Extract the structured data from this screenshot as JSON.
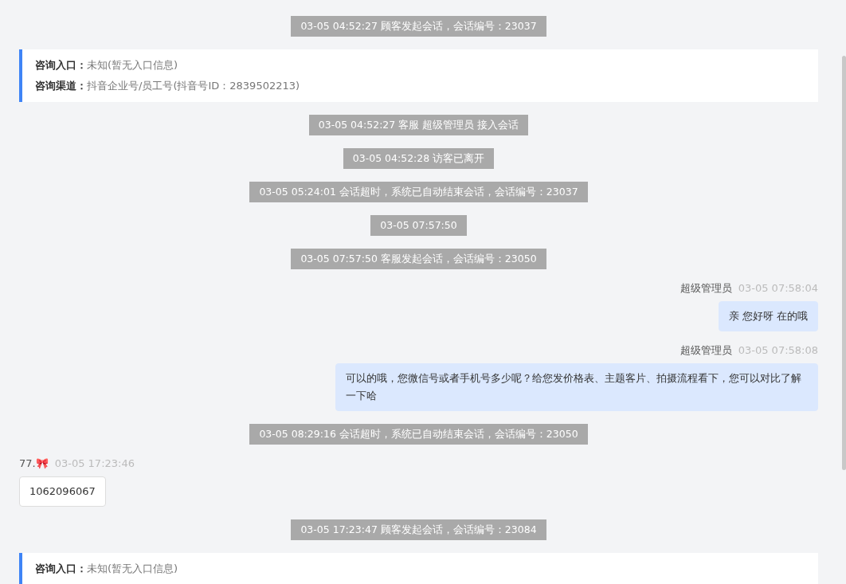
{
  "messages": [
    {
      "kind": "system",
      "text": "03-05 04:52:27 顾客发起会话，会话编号：23037"
    },
    {
      "kind": "info",
      "rows": [
        {
          "label": "咨询入口：",
          "value": "未知(暂无入口信息)"
        },
        {
          "label": "咨询渠道：",
          "value": "抖音企业号/员工号(抖音号ID：2839502213)"
        }
      ]
    },
    {
      "kind": "system",
      "text": "03-05 04:52:27 客服 超级管理员 接入会话"
    },
    {
      "kind": "system",
      "text": "03-05 04:52:28 访客已离开"
    },
    {
      "kind": "system",
      "text": "03-05 05:24:01 会话超时，系统已自动结束会话，会话编号：23037"
    },
    {
      "kind": "system",
      "text": "03-05 07:57:50"
    },
    {
      "kind": "system",
      "text": "03-05 07:57:50 客服发起会话，会话编号：23050"
    },
    {
      "kind": "agent",
      "sender": "超级管理员",
      "time": "03-05 07:58:04",
      "text": "亲 您好呀 在的哦"
    },
    {
      "kind": "agent",
      "sender": "超级管理员",
      "time": "03-05 07:58:08",
      "text": "可以的哦，您微信号或者手机号多少呢？给您发价格表、主题客片、拍摄流程看下，您可以对比了解一下哈"
    },
    {
      "kind": "system",
      "text": "03-05 08:29:16 会话超时，系统已自动结束会话，会话编号：23050"
    },
    {
      "kind": "visitor",
      "sender": "77.🎀",
      "time": "03-05 17:23:46",
      "text": "1062096067"
    },
    {
      "kind": "system",
      "text": "03-05 17:23:47 顾客发起会话，会话编号：23084"
    },
    {
      "kind": "info",
      "rows": [
        {
          "label": "咨询入口：",
          "value": "未知(暂无入口信息)"
        }
      ]
    }
  ]
}
